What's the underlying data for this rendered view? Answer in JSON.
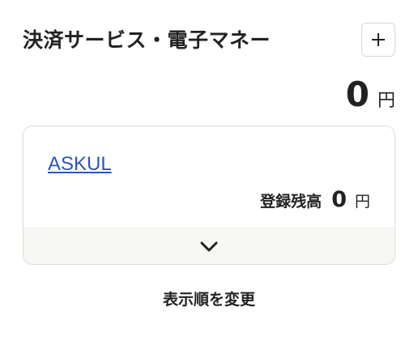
{
  "header": {
    "title": "決済サービス・電子マネー",
    "add_icon": "plus-icon"
  },
  "total": {
    "amount": "0",
    "unit": "円"
  },
  "services": [
    {
      "name": "ASKUL",
      "balance_label": "登録残高",
      "balance": "0",
      "unit": "円",
      "expand_icon": "chevron-down-icon"
    }
  ],
  "reorder_label": "表示順を変更",
  "colors": {
    "link": "#2a56b8",
    "text": "#222222",
    "card_border": "#dcdcdc",
    "card_footer_bg": "#f7f7f4"
  }
}
